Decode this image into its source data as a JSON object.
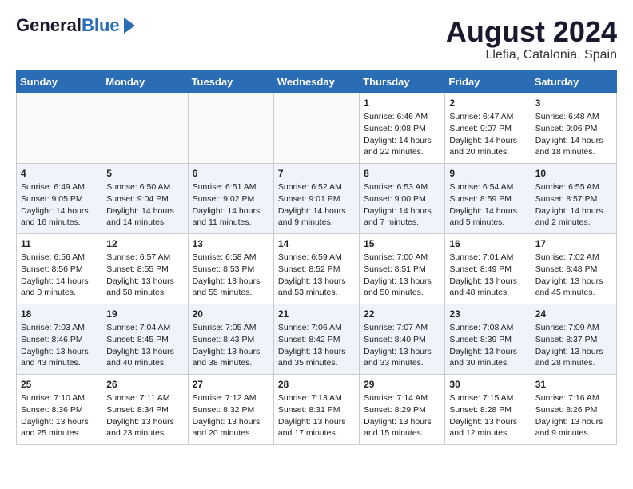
{
  "header": {
    "logo_line1": "General",
    "logo_line2": "Blue",
    "month_title": "August 2024",
    "location": "Llefia, Catalonia, Spain"
  },
  "days_of_week": [
    "Sunday",
    "Monday",
    "Tuesday",
    "Wednesday",
    "Thursday",
    "Friday",
    "Saturday"
  ],
  "weeks": [
    [
      {
        "day": "",
        "info": ""
      },
      {
        "day": "",
        "info": ""
      },
      {
        "day": "",
        "info": ""
      },
      {
        "day": "",
        "info": ""
      },
      {
        "day": "1",
        "info": "Sunrise: 6:46 AM\nSunset: 9:08 PM\nDaylight: 14 hours\nand 22 minutes."
      },
      {
        "day": "2",
        "info": "Sunrise: 6:47 AM\nSunset: 9:07 PM\nDaylight: 14 hours\nand 20 minutes."
      },
      {
        "day": "3",
        "info": "Sunrise: 6:48 AM\nSunset: 9:06 PM\nDaylight: 14 hours\nand 18 minutes."
      }
    ],
    [
      {
        "day": "4",
        "info": "Sunrise: 6:49 AM\nSunset: 9:05 PM\nDaylight: 14 hours\nand 16 minutes."
      },
      {
        "day": "5",
        "info": "Sunrise: 6:50 AM\nSunset: 9:04 PM\nDaylight: 14 hours\nand 14 minutes."
      },
      {
        "day": "6",
        "info": "Sunrise: 6:51 AM\nSunset: 9:02 PM\nDaylight: 14 hours\nand 11 minutes."
      },
      {
        "day": "7",
        "info": "Sunrise: 6:52 AM\nSunset: 9:01 PM\nDaylight: 14 hours\nand 9 minutes."
      },
      {
        "day": "8",
        "info": "Sunrise: 6:53 AM\nSunset: 9:00 PM\nDaylight: 14 hours\nand 7 minutes."
      },
      {
        "day": "9",
        "info": "Sunrise: 6:54 AM\nSunset: 8:59 PM\nDaylight: 14 hours\nand 5 minutes."
      },
      {
        "day": "10",
        "info": "Sunrise: 6:55 AM\nSunset: 8:57 PM\nDaylight: 14 hours\nand 2 minutes."
      }
    ],
    [
      {
        "day": "11",
        "info": "Sunrise: 6:56 AM\nSunset: 8:56 PM\nDaylight: 14 hours\nand 0 minutes."
      },
      {
        "day": "12",
        "info": "Sunrise: 6:57 AM\nSunset: 8:55 PM\nDaylight: 13 hours\nand 58 minutes."
      },
      {
        "day": "13",
        "info": "Sunrise: 6:58 AM\nSunset: 8:53 PM\nDaylight: 13 hours\nand 55 minutes."
      },
      {
        "day": "14",
        "info": "Sunrise: 6:59 AM\nSunset: 8:52 PM\nDaylight: 13 hours\nand 53 minutes."
      },
      {
        "day": "15",
        "info": "Sunrise: 7:00 AM\nSunset: 8:51 PM\nDaylight: 13 hours\nand 50 minutes."
      },
      {
        "day": "16",
        "info": "Sunrise: 7:01 AM\nSunset: 8:49 PM\nDaylight: 13 hours\nand 48 minutes."
      },
      {
        "day": "17",
        "info": "Sunrise: 7:02 AM\nSunset: 8:48 PM\nDaylight: 13 hours\nand 45 minutes."
      }
    ],
    [
      {
        "day": "18",
        "info": "Sunrise: 7:03 AM\nSunset: 8:46 PM\nDaylight: 13 hours\nand 43 minutes."
      },
      {
        "day": "19",
        "info": "Sunrise: 7:04 AM\nSunset: 8:45 PM\nDaylight: 13 hours\nand 40 minutes."
      },
      {
        "day": "20",
        "info": "Sunrise: 7:05 AM\nSunset: 8:43 PM\nDaylight: 13 hours\nand 38 minutes."
      },
      {
        "day": "21",
        "info": "Sunrise: 7:06 AM\nSunset: 8:42 PM\nDaylight: 13 hours\nand 35 minutes."
      },
      {
        "day": "22",
        "info": "Sunrise: 7:07 AM\nSunset: 8:40 PM\nDaylight: 13 hours\nand 33 minutes."
      },
      {
        "day": "23",
        "info": "Sunrise: 7:08 AM\nSunset: 8:39 PM\nDaylight: 13 hours\nand 30 minutes."
      },
      {
        "day": "24",
        "info": "Sunrise: 7:09 AM\nSunset: 8:37 PM\nDaylight: 13 hours\nand 28 minutes."
      }
    ],
    [
      {
        "day": "25",
        "info": "Sunrise: 7:10 AM\nSunset: 8:36 PM\nDaylight: 13 hours\nand 25 minutes."
      },
      {
        "day": "26",
        "info": "Sunrise: 7:11 AM\nSunset: 8:34 PM\nDaylight: 13 hours\nand 23 minutes."
      },
      {
        "day": "27",
        "info": "Sunrise: 7:12 AM\nSunset: 8:32 PM\nDaylight: 13 hours\nand 20 minutes."
      },
      {
        "day": "28",
        "info": "Sunrise: 7:13 AM\nSunset: 8:31 PM\nDaylight: 13 hours\nand 17 minutes."
      },
      {
        "day": "29",
        "info": "Sunrise: 7:14 AM\nSunset: 8:29 PM\nDaylight: 13 hours\nand 15 minutes."
      },
      {
        "day": "30",
        "info": "Sunrise: 7:15 AM\nSunset: 8:28 PM\nDaylight: 13 hours\nand 12 minutes."
      },
      {
        "day": "31",
        "info": "Sunrise: 7:16 AM\nSunset: 8:26 PM\nDaylight: 13 hours\nand 9 minutes."
      }
    ]
  ]
}
